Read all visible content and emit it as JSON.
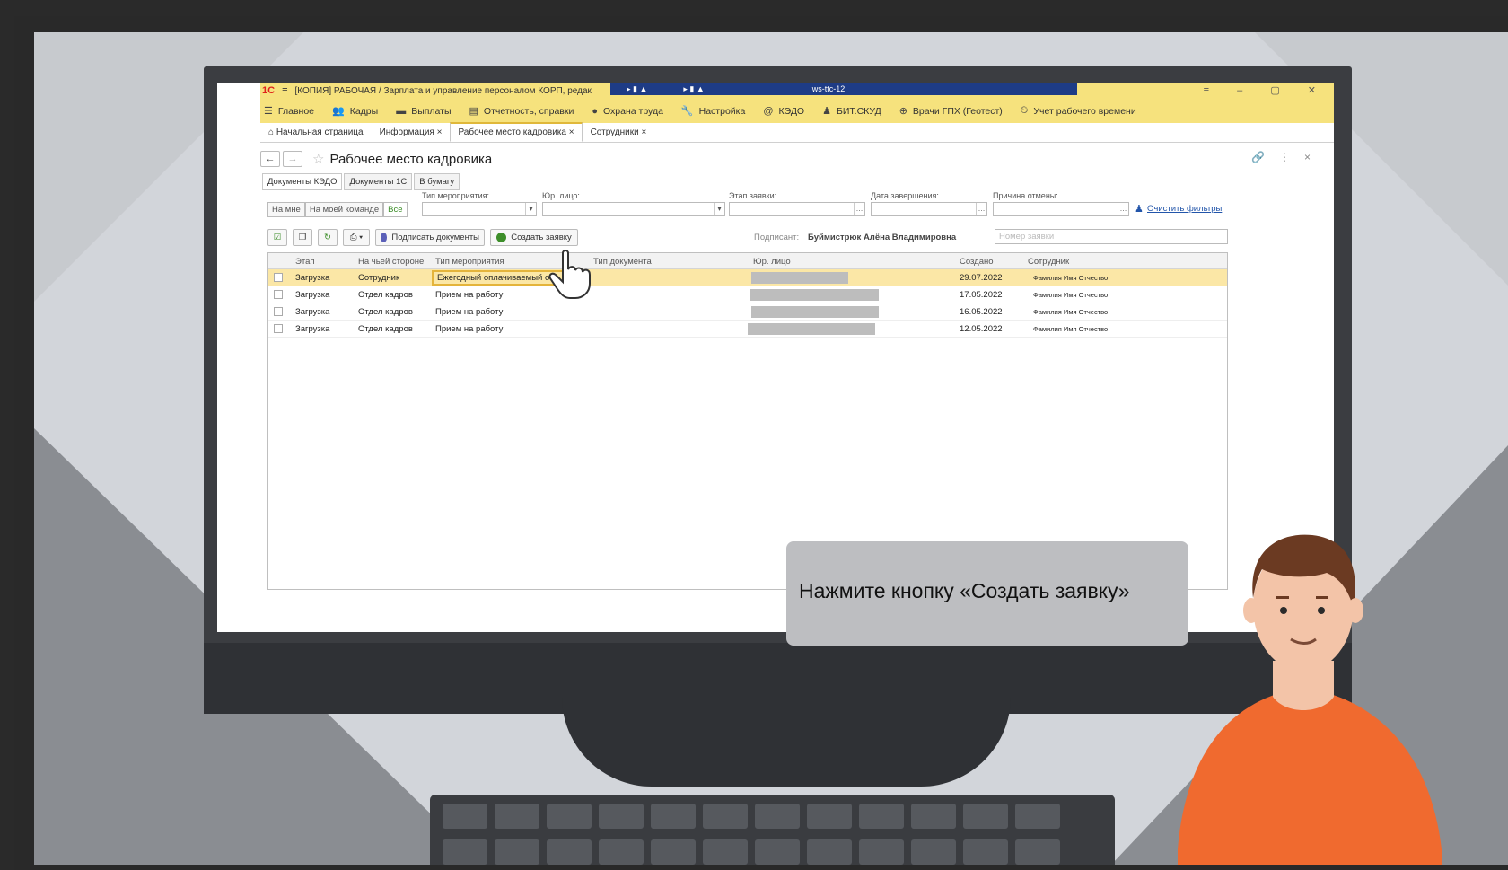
{
  "app": {
    "logo": "1С",
    "window_title": "[КОПИЯ] РАБОЧАЯ / Зарплата и управление персоналом КОРП, редак",
    "taskbar_item": "ws-ttc-12",
    "menu": [
      {
        "label": "Главное",
        "icon": "menu-icon"
      },
      {
        "label": "Кадры",
        "icon": "people-icon"
      },
      {
        "label": "Выплаты",
        "icon": "money-icon"
      },
      {
        "label": "Отчетность, справки",
        "icon": "report-icon"
      },
      {
        "label": "Охрана труда",
        "icon": "helmet-icon"
      },
      {
        "label": "Настройка",
        "icon": "wrench-icon"
      },
      {
        "label": "КЭДО",
        "icon": "at-icon"
      },
      {
        "label": "БИТ.СКУД",
        "icon": "user-check-icon"
      },
      {
        "label": "Врачи ГПХ (Геотест)",
        "icon": "doctor-icon"
      },
      {
        "label": "Учет рабочего времени",
        "icon": "clock-icon"
      }
    ],
    "tabs": [
      {
        "label": "Начальная страница",
        "closable": false
      },
      {
        "label": "Информация ×",
        "closable": true
      },
      {
        "label": "Рабочее место кадровика ×",
        "closable": true,
        "active": true
      },
      {
        "label": "Сотрудники ×",
        "closable": true
      }
    ],
    "page_title": "Рабочее место кадровика",
    "subtabs": [
      "Документы КЭДО",
      "Документы 1С",
      "В бумагу"
    ],
    "filters": {
      "segments": [
        "На мне",
        "На моей команде",
        "Все"
      ],
      "event_type_label": "Тип мероприятия:",
      "legal_entity_label": "Юр. лицо:",
      "stage_label": "Этап заявки:",
      "completion_date_label": "Дата завершения:",
      "cancel_reason_label": "Причина отмены:",
      "clear_filters": "Очистить фильтры"
    },
    "toolbar": {
      "sign_documents": "Подписать документы",
      "create_request": "Создать заявку",
      "signer_label": "Подписант:",
      "signer_name": "Буймистрюк Алёна Владимировна",
      "request_number_placeholder": "Номер заявки"
    },
    "grid": {
      "columns": [
        "Этап",
        "На чьей стороне",
        "Тип мероприятия",
        "Тип документа",
        "Юр. лицо",
        "Создано",
        "Сотрудник"
      ],
      "rows": [
        {
          "stage": "Загрузка",
          "side": "Сотрудник",
          "event": "Ежегодный оплачиваемый о",
          "doc": "",
          "created": "29.07.2022",
          "employee": "Фамилия Имя Отчество",
          "selected": true
        },
        {
          "stage": "Загрузка",
          "side": "Отдел кадров",
          "event": "Прием на работу",
          "doc": "",
          "created": "17.05.2022",
          "employee": "Фамилия Имя Отчество",
          "selected": false
        },
        {
          "stage": "Загрузка",
          "side": "Отдел кадров",
          "event": "Прием на работу",
          "doc": "",
          "created": "16.05.2022",
          "employee": "Фамилия Имя Отчество",
          "selected": false
        },
        {
          "stage": "Загрузка",
          "side": "Отдел кадров",
          "event": "Прием на работу",
          "doc": "",
          "created": "12.05.2022",
          "employee": "Фамилия Имя Отчество",
          "selected": false
        }
      ]
    }
  },
  "tutorial": {
    "hint": "Нажмите кнопку «Создать заявку»"
  },
  "colors": {
    "menubar": "#f6e27d",
    "selected_row": "#fbe7a6",
    "shirt": "#f06a2f",
    "hair": "#6b3a22"
  }
}
